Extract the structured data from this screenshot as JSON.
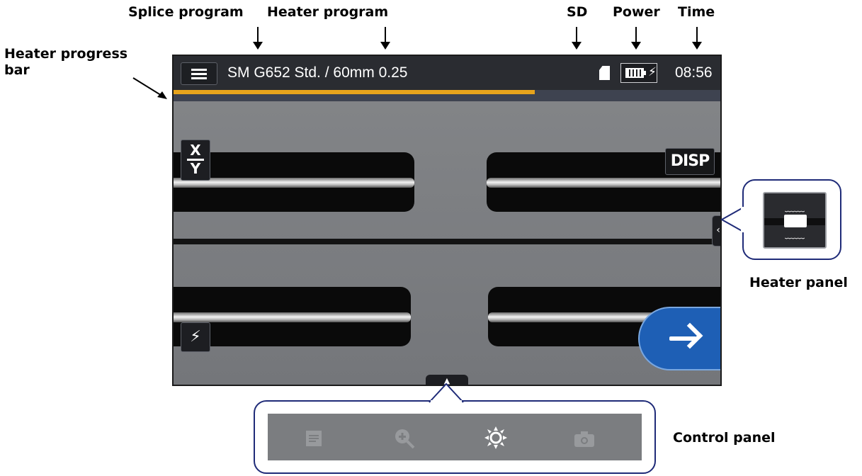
{
  "callouts": {
    "splice_program": "Splice program",
    "heater_program": "Heater program",
    "sd": "SD",
    "power": "Power",
    "time": "Time",
    "heater_progress_bar_line1": "Heater progress",
    "heater_progress_bar_line2": "bar",
    "heater_panel": "Heater panel",
    "control_panel": "Control panel"
  },
  "status_bar": {
    "program_text": "SM G652 Std. / 60mm 0.25",
    "time": "08:56",
    "sd_icon": "sd-card-icon",
    "battery_icon": "battery-charging-icon"
  },
  "heater_progress": {
    "fraction": 0.66,
    "color": "#e7a41c"
  },
  "buttons": {
    "xy_top": "X",
    "xy_bottom": "Y",
    "disp": "DISP",
    "arc": "⚡",
    "heater_tab": "‹",
    "panel_tab": "▲"
  },
  "control_panel_icons": [
    {
      "name": "report-icon",
      "active": false
    },
    {
      "name": "zoom-in-icon",
      "active": false
    },
    {
      "name": "brightness-icon",
      "active": true
    },
    {
      "name": "camera-icon",
      "active": false
    }
  ],
  "colors": {
    "accent_next": "#1e5fb5",
    "callout_border": "#1f2b78"
  }
}
